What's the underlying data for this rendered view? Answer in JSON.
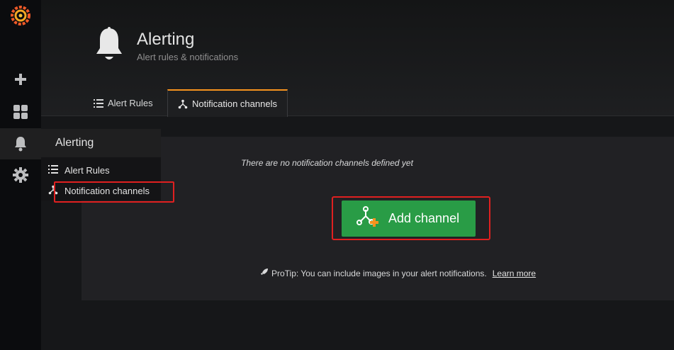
{
  "page": {
    "title": "Alerting",
    "subtitle": "Alert rules & notifications"
  },
  "tabs": [
    {
      "label": "Alert Rules",
      "icon": "list-icon",
      "active": false
    },
    {
      "label": "Notification channels",
      "icon": "channels-icon",
      "active": true
    }
  ],
  "sidemenu": {
    "items": [
      {
        "name": "grafana-logo",
        "icon": "grafana-logo-icon"
      },
      {
        "name": "create",
        "icon": "plus-icon"
      },
      {
        "name": "dashboards",
        "icon": "dashboards-icon"
      },
      {
        "name": "alerting",
        "icon": "bell-icon",
        "active": true
      },
      {
        "name": "configuration",
        "icon": "gear-icon"
      }
    ]
  },
  "flyout": {
    "header": "Alerting",
    "items": [
      {
        "label": "Alert Rules",
        "icon": "list-icon"
      },
      {
        "label": "Notification channels",
        "icon": "channels-icon"
      }
    ]
  },
  "empty_state": {
    "message": "There are no notification channels defined yet",
    "button_label": "Add channel",
    "protip": "ProTip: You can include images in your alert notifications.",
    "learn_more": "Learn more"
  },
  "colors": {
    "accent_green": "#299c46",
    "highlight_red": "#e02020",
    "tab_accent": "#f7931e",
    "background": "#161719"
  }
}
